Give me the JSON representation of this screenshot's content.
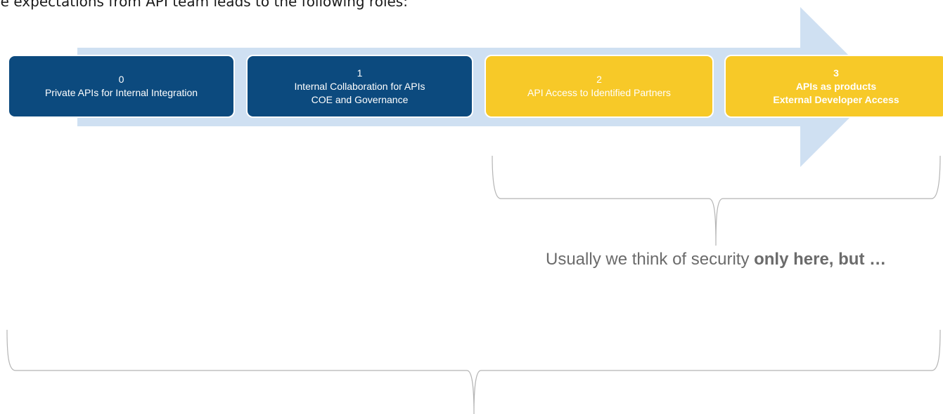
{
  "intro_text": "he expectations from API team leads to the following roles:",
  "stages": [
    {
      "number": "0",
      "lines": [
        "Private APIs for Internal Integration"
      ]
    },
    {
      "number": "1",
      "lines": [
        "Internal Collaboration for APIs",
        "COE and Governance"
      ]
    },
    {
      "number": "2",
      "lines": [
        "API Access to Identified Partners"
      ]
    },
    {
      "number": "3",
      "lines": [
        "APIs as products",
        "External Developer Access"
      ]
    }
  ],
  "note": {
    "prefix": "Usually we think of security ",
    "emphasis": "only here, but …"
  },
  "colors": {
    "arrow": "#cfe0f2",
    "dark_box": "#0c4a7e",
    "yellow_box": "#f7c928",
    "brace": "#b5b5b5",
    "note_text": "#6b6b6b"
  }
}
